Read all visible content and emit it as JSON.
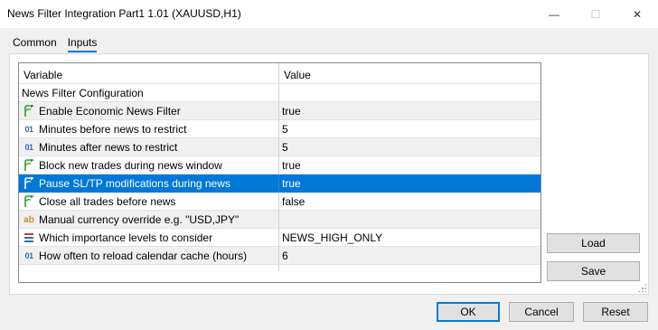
{
  "window": {
    "title": "News Filter Integration Part1 1.01 (XAUUSD,H1)",
    "minimize_glyph": "—",
    "maximize_glyph": "☐",
    "close_glyph": "✕"
  },
  "tabs": [
    {
      "label": "Common",
      "active": false
    },
    {
      "label": "Inputs",
      "active": true
    }
  ],
  "grid": {
    "columns": {
      "variable": "Variable",
      "value": "Value"
    },
    "rows": [
      {
        "icon": "none",
        "variable": "News Filter Configuration",
        "value": "",
        "style": "group"
      },
      {
        "icon": "bool-arrow-icon",
        "variable": "Enable Economic News Filter",
        "value": "true",
        "style": "alt"
      },
      {
        "icon": "int-icon",
        "variable": "Minutes before news to restrict",
        "value": "5",
        "style": "normal"
      },
      {
        "icon": "int-icon",
        "variable": "Minutes after news to restrict",
        "value": "5",
        "style": "alt"
      },
      {
        "icon": "bool-arrow-icon",
        "variable": "Block new trades during news window",
        "value": "true",
        "style": "normal"
      },
      {
        "icon": "bool-arrow-icon",
        "variable": "Pause SL/TP modifications during news",
        "value": "true",
        "style": "selected"
      },
      {
        "icon": "bool-arrow-icon",
        "variable": "Close all trades before news",
        "value": "false",
        "style": "normal"
      },
      {
        "icon": "string-icon",
        "variable": "Manual currency override e.g. \"USD,JPY\"",
        "value": "",
        "style": "alt"
      },
      {
        "icon": "enum-icon",
        "variable": "Which importance levels to consider",
        "value": "NEWS_HIGH_ONLY",
        "style": "normal"
      },
      {
        "icon": "int-icon",
        "variable": "How often to reload calendar cache (hours)",
        "value": "6",
        "style": "alt"
      }
    ]
  },
  "buttons": {
    "load": "Load",
    "save": "Save",
    "ok": "OK",
    "cancel": "Cancel",
    "reset": "Reset"
  },
  "icon_glyphs": {
    "int": "01",
    "string": "ab"
  },
  "colors": {
    "selection": "#0078d7",
    "bool_arrow": "#2e9b2e",
    "enum_red": "#d9342b",
    "enum_blue": "#2f6fb7"
  }
}
